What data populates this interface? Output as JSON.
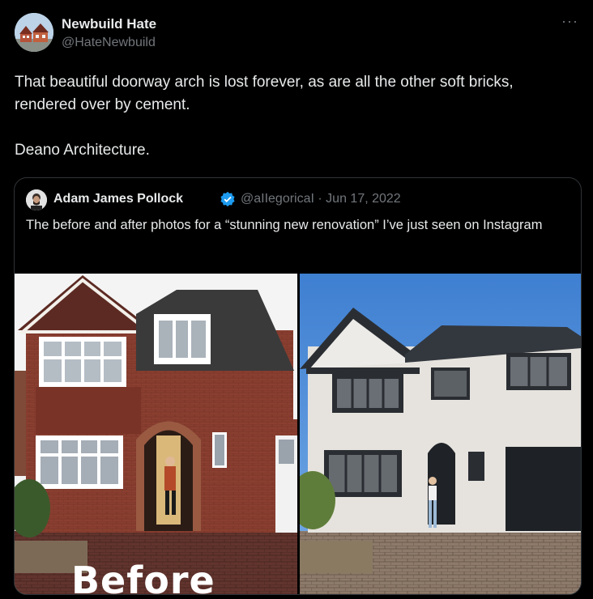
{
  "tweet": {
    "author_name": "Newbuild Hate",
    "author_handle": "@HateNewbuild",
    "more_icon": "more-horizontal-icon",
    "text_line1": "That beautiful doorway arch is lost forever, as are all the other soft bricks, rendered over by cement.",
    "text_line2": "Deano Architecture."
  },
  "quoted": {
    "author_name": "Adam James Pollock",
    "verified_badge": "verified-badge-icon",
    "handle_date": "@aIIegoricaI · Jun 17, 2022",
    "text": "The before and after photos for a “stunning new renovation” I’ve just seen on Instagram",
    "photos": {
      "before_caption": "Before"
    }
  },
  "colors": {
    "background": "#000000",
    "text_primary": "#e7e9ea",
    "text_secondary": "#71767b",
    "border": "#2f3336",
    "verified": "#1d9bf0"
  }
}
